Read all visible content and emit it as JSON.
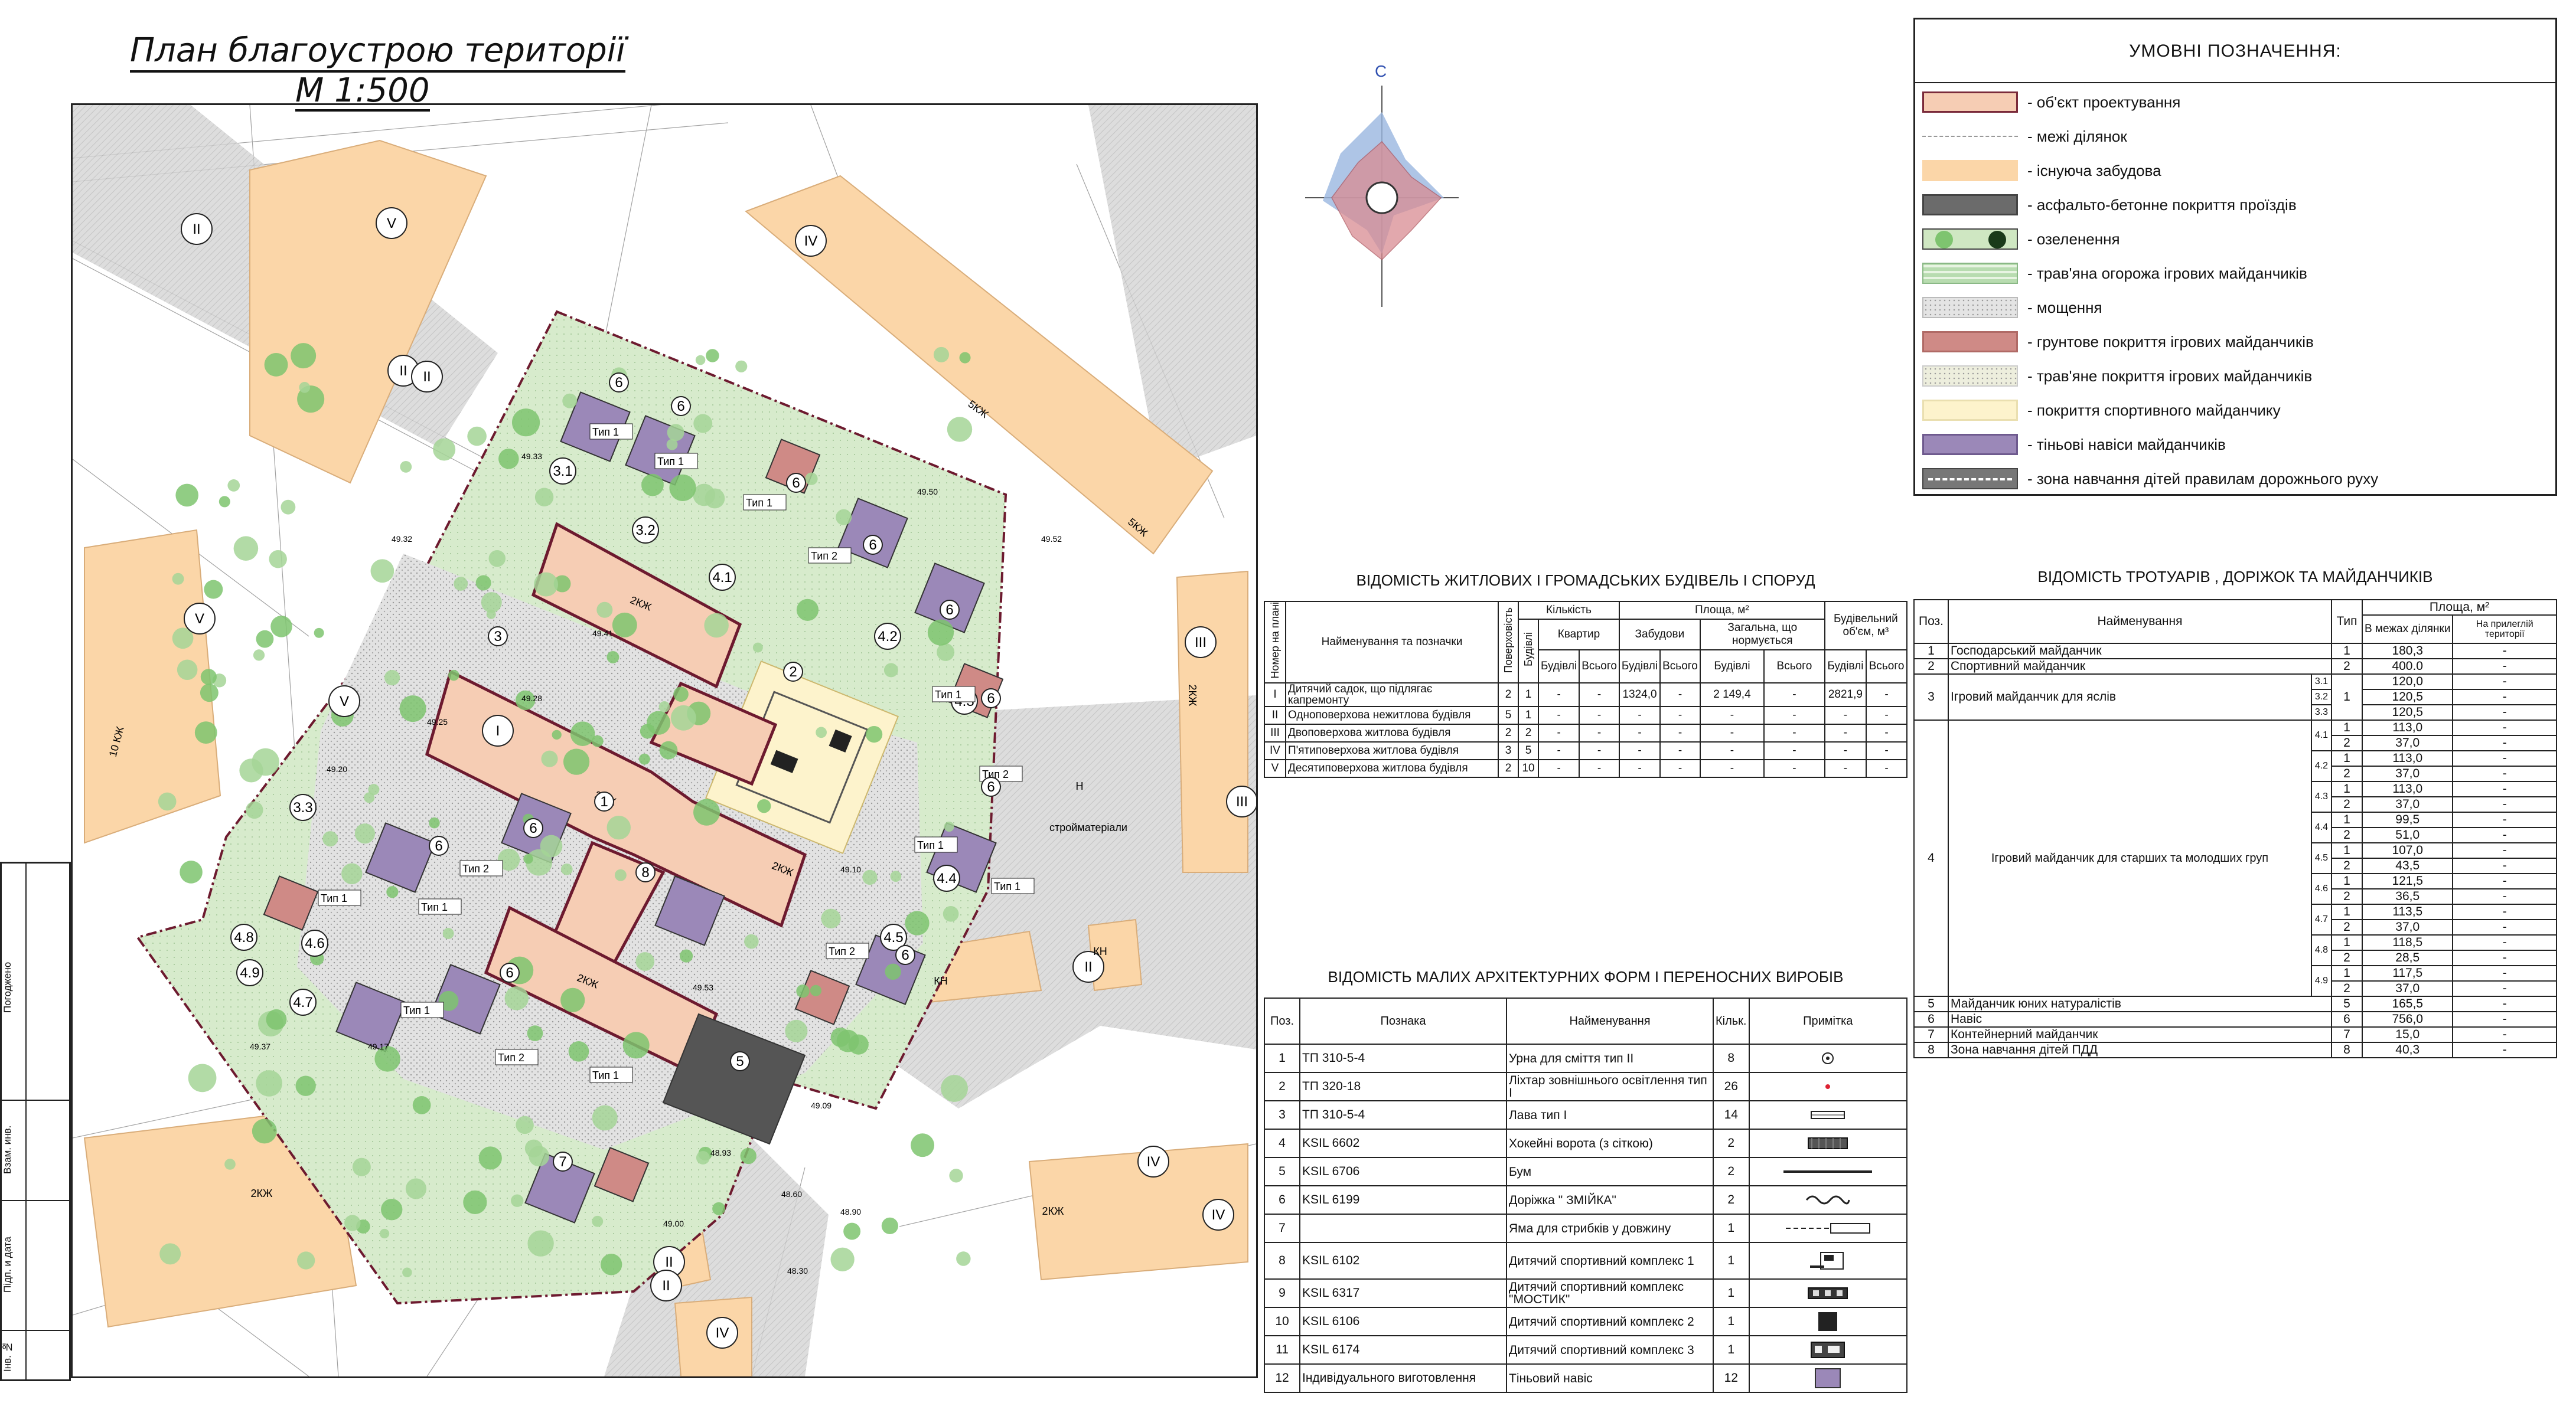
{
  "title": {
    "line1": "План благоустрою території",
    "line2": "М 1:500"
  },
  "compass": {
    "north_label": "С"
  },
  "stamp": [
    "Погоджено",
    "Взам. инв.",
    "Підп. и дата",
    "Інв. №"
  ],
  "legend": {
    "title": "УМОВНІ ПОЗНАЧЕННЯ:",
    "items": [
      {
        "label": "- об'єкт проектування",
        "color": "#f6cdb4",
        "border": "#7a2a3a",
        "pattern": "solid"
      },
      {
        "label": "- межі ділянок",
        "color": "#ffffff",
        "border": "#ffffff",
        "pattern": "dash"
      },
      {
        "label": "- існуюча забудова",
        "color": "#fbd6a8",
        "border": "#fbd6a8",
        "pattern": "solid"
      },
      {
        "label": "- асфальто-бетонне покриття проїздів",
        "color": "#6b6b6b",
        "border": "#444444",
        "pattern": "solid"
      },
      {
        "label": "- озеленення",
        "color": "#cfe7c2",
        "border": "#444444",
        "pattern": "trees"
      },
      {
        "label": "- трав'яна огорожа ігрових майданчиків",
        "color": "#b8dcb0",
        "border": "#8ab886",
        "pattern": "stripes"
      },
      {
        "label": "- мощення",
        "color": "#e4e4e4",
        "border": "#bbbbbb",
        "pattern": "dots"
      },
      {
        "label": "- грунтове покриття ігрових майданчиків",
        "color": "#cf8a86",
        "border": "#b06a66",
        "pattern": "solid"
      },
      {
        "label": "- трав'яне покриття ігрових майданчиків",
        "color": "#edeedd",
        "border": "#cccccc",
        "pattern": "dots"
      },
      {
        "label": "- покриття спортивного майданчику",
        "color": "#fdf3cc",
        "border": "#eadfb0",
        "pattern": "solid"
      },
      {
        "label": "- тіньові навіси майданчиків",
        "color": "#9b88b8",
        "border": "#6e5a8e",
        "pattern": "solid"
      },
      {
        "label": "- зона навчання дітей правилам дорожнього руху",
        "color": "#777777",
        "border": "#444444",
        "pattern": "road"
      }
    ]
  },
  "buildings_table": {
    "title": "ВІДОМІСТЬ ЖИТЛОВИХ І ГРОМАДСЬКИХ БУДІВЕЛЬ І СПОРУД",
    "headers": {
      "num": "Номер на плані",
      "name": "Найменування та позначки",
      "floors": "Поверховість",
      "count": "Кількість",
      "buildings": "Будівлі",
      "apartments": "Квартир",
      "area": "Площа, м²",
      "built": "Забудови",
      "total_norm": "Загальна, що нормується",
      "volume": "Будівельний об'єм, м³",
      "per_bld": "Будівлі",
      "all": "Всього"
    },
    "rows": [
      {
        "num": "I",
        "name": "Дитячий садок, що підлягає капремонту",
        "floors": "2",
        "bld": "1",
        "apt_b": "-",
        "apt_all": "-",
        "built_b": "1324,0",
        "built_all": "-",
        "tot_b": "2 149,4",
        "tot_all": "-",
        "vol_b": "2821,9",
        "vol_all": "-"
      },
      {
        "num": "II",
        "name": "Одноповерхова нежитлова будівля",
        "floors": "5",
        "bld": "1",
        "apt_b": "-",
        "apt_all": "-",
        "built_b": "-",
        "built_all": "-",
        "tot_b": "-",
        "tot_all": "-",
        "vol_b": "-",
        "vol_all": "-"
      },
      {
        "num": "III",
        "name": "Двоповерхова житлова будівля",
        "floors": "2",
        "bld": "2",
        "apt_b": "-",
        "apt_all": "-",
        "built_b": "-",
        "built_all": "-",
        "tot_b": "-",
        "tot_all": "-",
        "vol_b": "-",
        "vol_all": "-"
      },
      {
        "num": "IV",
        "name": "П'ятиповерхова житлова будівля",
        "floors": "3",
        "bld": "5",
        "apt_b": "-",
        "apt_all": "-",
        "built_b": "-",
        "built_all": "-",
        "tot_b": "-",
        "tot_all": "-",
        "vol_b": "-",
        "vol_all": "-"
      },
      {
        "num": "V",
        "name": "Десятиповерхова житлова будівля",
        "floors": "2",
        "bld": "10",
        "apt_b": "-",
        "apt_all": "-",
        "built_b": "-",
        "built_all": "-",
        "tot_b": "-",
        "tot_all": "-",
        "vol_b": "-",
        "vol_all": "-"
      }
    ]
  },
  "forms_table": {
    "title": "ВІДОМІСТЬ МАЛИХ АРХІТЕКТУРНИХ ФОРМ І ПЕРЕНОСНИХ ВИРОБІВ",
    "headers": {
      "pos": "Поз.",
      "code": "Познака",
      "name": "Найменування",
      "qty": "Кільк.",
      "note": "Примітка"
    },
    "rows": [
      {
        "pos": "1",
        "code": "ТП 310-5-4",
        "name": "Урна для сміття тип II",
        "qty": "8",
        "sym": "urn"
      },
      {
        "pos": "2",
        "code": "ТП 320-18",
        "name": "Ліхтар зовнішнього освітлення тип I",
        "qty": "26",
        "sym": "lamp"
      },
      {
        "pos": "3",
        "code": "ТП 310-5-4",
        "name": "Лава тип I",
        "qty": "14",
        "sym": "bench"
      },
      {
        "pos": "4",
        "code": "KSIL 6602",
        "name": "Хокейні ворота (з сіткою)",
        "qty": "2",
        "sym": "goal"
      },
      {
        "pos": "5",
        "code": "KSIL 6706",
        "name": "Бум",
        "qty": "2",
        "sym": "beam"
      },
      {
        "pos": "6",
        "code": "KSIL 6199",
        "name": "Доріжка \" ЗМІЙКА\"",
        "qty": "2",
        "sym": "snake"
      },
      {
        "pos": "7",
        "code": "",
        "name": "Яма для стрибків у довжину",
        "qty": "1",
        "sym": "pit"
      },
      {
        "pos": "8",
        "code": "KSIL 6102",
        "name": "Дитячий спортивний комплекс 1",
        "qty": "1",
        "sym": "c1"
      },
      {
        "pos": "9",
        "code": "KSIL 6317",
        "name": "Дитячий спортивний комплекс \"МОСТИК\"",
        "qty": "1",
        "sym": "c2"
      },
      {
        "pos": "10",
        "code": "KSIL 6106",
        "name": "Дитячий спортивний комплекс 2",
        "qty": "1",
        "sym": "c3"
      },
      {
        "pos": "11",
        "code": "KSIL 6174",
        "name": "Дитячий спортивний комплекс 3",
        "qty": "1",
        "sym": "c4"
      },
      {
        "pos": "12",
        "code": "Індивідуального виготовлення",
        "name": "Тіньовий навіс",
        "qty": "12",
        "sym": "shade"
      }
    ]
  },
  "paths_table": {
    "title": "ВІДОМІСТЬ ТРОТУАРІВ , ДОРІЖОК ТА МАЙДАНЧИКІВ",
    "headers": {
      "pos": "Поз.",
      "name": "Найменування",
      "type": "Тип",
      "area": "Площа, м²",
      "in_site": "В межах ділянки",
      "adjacent": "На прилеглій території"
    },
    "simple_rows": [
      {
        "pos": "1",
        "name": "Господарський майданчик",
        "type": "1",
        "in": "180,3",
        "adj": "-"
      },
      {
        "pos": "2",
        "name": "Спортивний майданчик",
        "type": "2",
        "in": "400.0",
        "adj": "-"
      }
    ],
    "row3": {
      "pos": "3",
      "name": "Ігровий майданчик для яслів",
      "type": "1",
      "subs": [
        {
          "sub": "3.1",
          "in": "120,0",
          "adj": "-"
        },
        {
          "sub": "3.2",
          "in": "120,5",
          "adj": "-"
        },
        {
          "sub": "3.3",
          "in": "120,5",
          "adj": "-"
        }
      ]
    },
    "row4": {
      "pos": "4",
      "name": "Ігровий майданчик для старших та молодших груп",
      "groups": [
        {
          "sub": "4.1",
          "rows": [
            {
              "t": "1",
              "in": "113,0"
            },
            {
              "t": "2",
              "in": "37,0"
            }
          ]
        },
        {
          "sub": "4.2",
          "rows": [
            {
              "t": "1",
              "in": "113,0"
            },
            {
              "t": "2",
              "in": "37,0"
            }
          ]
        },
        {
          "sub": "4.3",
          "rows": [
            {
              "t": "1",
              "in": "113,0"
            },
            {
              "t": "2",
              "in": "37,0"
            }
          ]
        },
        {
          "sub": "4.4",
          "rows": [
            {
              "t": "1",
              "in": "99,5"
            },
            {
              "t": "2",
              "in": "51,0"
            }
          ]
        },
        {
          "sub": "4.5",
          "rows": [
            {
              "t": "1",
              "in": "107,0"
            },
            {
              "t": "2",
              "in": "43,5"
            }
          ]
        },
        {
          "sub": "4.6",
          "rows": [
            {
              "t": "1",
              "in": "121,5"
            },
            {
              "t": "2",
              "in": "36,5"
            }
          ]
        },
        {
          "sub": "4.7",
          "rows": [
            {
              "t": "1",
              "in": "113,5"
            },
            {
              "t": "2",
              "in": "37,0"
            }
          ]
        },
        {
          "sub": "4.8",
          "rows": [
            {
              "t": "1",
              "in": "118,5"
            },
            {
              "t": "2",
              "in": "28,5"
            }
          ]
        },
        {
          "sub": "4.9",
          "rows": [
            {
              "t": "1",
              "in": "117,5"
            },
            {
              "t": "2",
              "in": "37,0"
            }
          ]
        }
      ]
    },
    "tail_rows": [
      {
        "pos": "5",
        "name": "Майданчик юних натуралістів",
        "type": "5",
        "in": "165,5",
        "adj": "-"
      },
      {
        "pos": "6",
        "name": "Навіс",
        "type": "6",
        "in": "756,0",
        "adj": "-"
      },
      {
        "pos": "7",
        "name": "Контейнерний майданчик",
        "type": "7",
        "in": "15,0",
        "adj": "-"
      },
      {
        "pos": "8",
        "name": "Зона навчання дітей ПДД",
        "type": "8",
        "in": "40,3",
        "adj": "-"
      }
    ]
  },
  "plan": {
    "building_labels": [
      "V",
      "II",
      "II",
      "V",
      "V",
      "IV",
      "III",
      "II",
      "IV",
      "II",
      "IV",
      "III",
      "IV",
      "II",
      "II",
      "I"
    ],
    "kindergarten_label": "I",
    "plan_notes": [
      "2КЖ",
      "2КЖ",
      "2КЖ",
      "5КЖ",
      "5КЖ",
      "10 КЖ",
      "2КЖ",
      "2КЖ",
      "2КЖ",
      "2КЖ",
      "КН",
      "КН",
      "Н"
    ],
    "playground_ids": [
      "3.1",
      "3.2",
      "4.1",
      "4.2",
      "4.3",
      "3.3",
      "4.4",
      "4.5",
      "4.6",
      "4.7",
      "4.8",
      "4.9"
    ],
    "type_labels": [
      "Тип 1",
      "Тип 1",
      "Тип 1",
      "Тип 2",
      "Тип 1",
      "Тип 2",
      "Тип 1",
      "Тип 2",
      "Тип 1",
      "Тип 2",
      "Тип 1",
      "Тип 1",
      "Тип 2",
      "Тип 1",
      "Тип 1"
    ],
    "item_markers": [
      "6",
      "6",
      "6",
      "6",
      "6",
      "6",
      "6",
      "6",
      "6",
      "6",
      "6",
      "7",
      "8",
      "2",
      "5",
      "1",
      "3"
    ],
    "street_text": "строймате­ріали",
    "elevations": [
      "49.33",
      "49.41",
      "49.53",
      "49.32",
      "49.20",
      "49.25",
      "49.28",
      "49.10",
      "49.09",
      "49.17",
      "49.37",
      "49.00",
      "48.30",
      "48.60",
      "49.50",
      "49.52",
      "48.93",
      "48.90"
    ]
  },
  "colors": {
    "project": "#f6cdb4",
    "existing": "#fbd6a8",
    "asphalt": "#6b6b6b",
    "green": "#cfe7c2",
    "paving": "#e4e4e4",
    "soil": "#cf8a86",
    "sport": "#fdf3cc",
    "shade": "#9b88b8",
    "boundary": "#6d1a2f",
    "road": "#d8d8d8"
  }
}
